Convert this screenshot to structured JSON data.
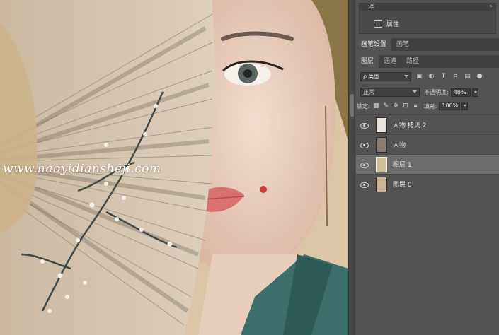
{
  "canvas": {
    "watermark": "www.haoyidiansheji.com"
  },
  "properties_panel": {
    "label": "属性",
    "collapse_glyph": "»",
    "top_glyph": "淬"
  },
  "history_tabs": [
    {
      "label": "画笔设置",
      "active": true
    },
    {
      "label": "画笔",
      "active": false
    }
  ],
  "layers_tabs": [
    {
      "label": "图层",
      "active": true
    },
    {
      "label": "通道",
      "active": false
    },
    {
      "label": "路径",
      "active": false
    }
  ],
  "filter": {
    "kind": "类型",
    "search_glyph": "ρ"
  },
  "blend": {
    "mode": "正常",
    "opacity_label": "不透明度:",
    "opacity_value": "48%"
  },
  "lock": {
    "label": "锁定:",
    "fill_label": "填充:",
    "fill_value": "100%"
  },
  "layers": [
    {
      "name": "人物 拷贝 2",
      "selected": false,
      "thumb": "#e8e3dc"
    },
    {
      "name": "人物",
      "selected": false,
      "thumb": "#8a7c72"
    },
    {
      "name": "图层 1",
      "selected": true,
      "thumb": "#cdbd99"
    },
    {
      "name": "图层 0",
      "selected": false,
      "thumb": "#c9b694"
    }
  ]
}
